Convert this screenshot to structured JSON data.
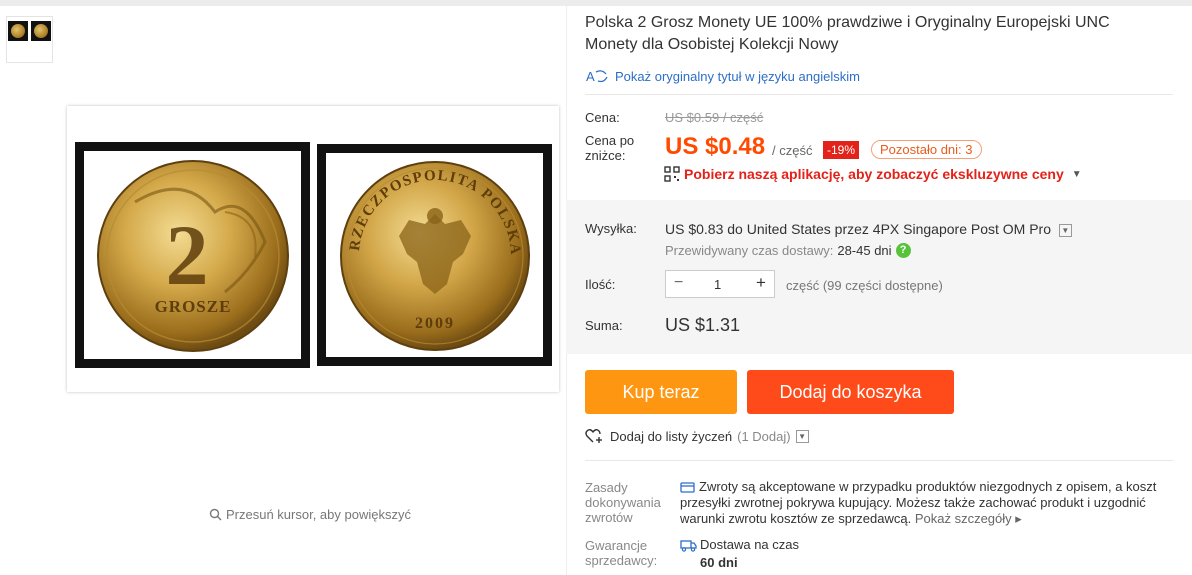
{
  "product": {
    "title": "Polska 2 Grosz Monety UE 100% prawdziwe i Oryginalny Europejski UNC Monety dla Osobistej Kolekcji Nowy",
    "translate_link": "Pokaż oryginalny tytuł w języku angielskim"
  },
  "gallery": {
    "zoom_hint": "Przesuń kursor, aby powiększyć"
  },
  "price": {
    "label": "Cena:",
    "original": "US $0.59 / część",
    "discount_label": "Cena po zniżce:",
    "current": "US $0.48",
    "per_unit": "/ część",
    "discount_badge": "-19%",
    "days_left": "Pozostało dni: 3",
    "app_promo": "Pobierz naszą aplikację, aby zobaczyć ekskluzywne ceny"
  },
  "shipping": {
    "label": "Wysyłka:",
    "cost": "US $0.83",
    "to_word": "do",
    "destination": "United States przez 4PX Singapore Post OM Pro",
    "delivery_label": "Przewidywany czas dostawy:",
    "delivery_days": "28-45 dni"
  },
  "quantity": {
    "label": "Ilość:",
    "value": "1",
    "available": "część (99 części dostępne)"
  },
  "total": {
    "label": "Suma:",
    "value": "US $1.31"
  },
  "actions": {
    "buy_now": "Kup teraz",
    "add_to_cart": "Dodaj do koszyka",
    "wishlist": "Dodaj do listy życzeń",
    "wishlist_count": "(1 Dodaj)"
  },
  "returns": {
    "label": "Zasady dokonywania zwrotów",
    "text": "Zwroty są akceptowane w przypadku produktów niezgodnych z opisem, a koszt przesyłki zwrotnej pokrywa kupujący. Możesz także zachować produkt i uzgodnić warunki zwrotu kosztów ze sprzedawcą.",
    "more": "Pokaż szczegóły"
  },
  "guarantee": {
    "label": "Gwarancje sprzedawcy:",
    "item": "Dostawa na czas",
    "value": "60 dni"
  },
  "coin_text": {
    "denomination": "2",
    "currency": "GROSZE",
    "legend": "RZECZPOSPOLITA POLSKA",
    "year": "2009"
  },
  "colors": {
    "accent_price": "#ff4a00",
    "buy_button": "#ff9611",
    "cart_button": "#ff4a1a",
    "badge": "#e32219",
    "link": "#2d6ec8"
  }
}
